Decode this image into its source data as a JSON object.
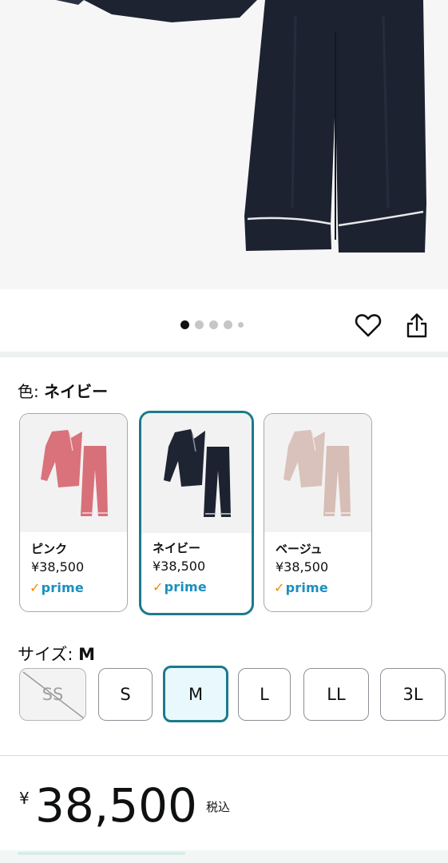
{
  "product_image": {
    "alt_icon": "navy-pajama-photo"
  },
  "carousel": {
    "dot_count": 5,
    "active_index": 0
  },
  "actions": {
    "wishlist_icon": "heart-icon",
    "share_icon": "share-icon"
  },
  "color": {
    "label": "色:",
    "selected": "ネイビー",
    "options": [
      {
        "name": "ピンク",
        "price": "¥38,500",
        "prime": "prime",
        "color": "#d9727a"
      },
      {
        "name": "ネイビー",
        "price": "¥38,500",
        "prime": "prime",
        "color": "#1e2432"
      },
      {
        "name": "ベージュ",
        "price": "¥38,500",
        "prime": "prime",
        "color": "#d9c2bb"
      }
    ]
  },
  "size": {
    "label": "サイズ:",
    "selected": "M",
    "options": [
      "SS",
      "S",
      "M",
      "L",
      "LL",
      "3L"
    ],
    "unavailable": [
      "SS"
    ]
  },
  "price": {
    "currency": "¥",
    "amount": "38,500",
    "tax_note": "税込"
  },
  "colors": {
    "accent": "#1d7a8b",
    "prime_blue": "#1a8fbf",
    "prime_check": "#f08804"
  }
}
